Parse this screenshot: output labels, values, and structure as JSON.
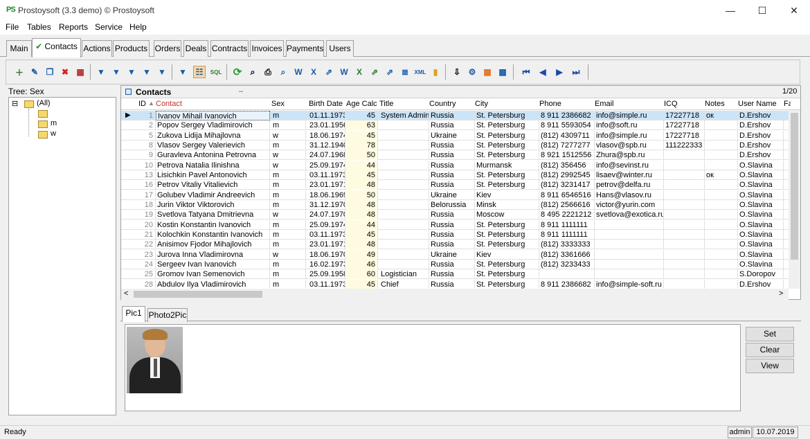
{
  "window": {
    "title": "Prostoysoft (3.3 demo) © Prostoysoft",
    "app_icon_text": "PS",
    "minimize": "—",
    "maximize": "☐",
    "close": "✕"
  },
  "menu": [
    "File",
    "Tables",
    "Reports",
    "Service",
    "Help"
  ],
  "tabs": [
    "Main",
    "Contacts",
    "Actions",
    "Products",
    "Orders",
    "Deals",
    "Contracts",
    "Invoices",
    "Payments",
    "Users"
  ],
  "active_tab_check": "✔",
  "tree": {
    "label": "Tree: Sex",
    "root": "(All)",
    "children": [
      "",
      "m",
      "w"
    ],
    "expander": "⊟"
  },
  "grid": {
    "title": "Contacts",
    "title_mark": "–",
    "pager": "1/20",
    "columns": [
      "ID",
      "Contact",
      "Sex",
      "Birth Date",
      "Age Calc",
      "Title",
      "Country",
      "City",
      "Phone",
      "Email",
      "ICQ",
      "Notes",
      "User Name",
      "Fa"
    ],
    "sort_marker": "▲",
    "row_pointer": "▶",
    "rows": [
      [
        "1",
        "Ivanov Mihail Ivanovich",
        "m",
        "01.11.1973",
        "45",
        "System Adminis",
        "Russia",
        "St. Petersburg",
        "8 911 2386682",
        "info@simple.ru",
        "17227718",
        "ок",
        "D.Ershov"
      ],
      [
        "2",
        "Popov Sergey Vladimirovich",
        "m",
        "23.01.1956",
        "63",
        "",
        "Russia",
        "St. Petersburg",
        "8 911 5593054",
        "info@soft.ru",
        "17227718",
        "",
        "D.Ershov"
      ],
      [
        "5",
        "Zukova Lidija Mihajlovna",
        "w",
        "18.06.1974",
        "45",
        "",
        "Ukraine",
        "St. Petersburg",
        "(812) 4309711",
        "info@simple.ru",
        "17227718",
        "",
        "D.Ershov"
      ],
      [
        "8",
        "Vlasov Sergey Valerievich",
        "m",
        "31.12.1940",
        "78",
        "",
        "Russia",
        "St. Petersburg",
        "(812) 7277277",
        "vlasov@spb.ru",
        "111222333",
        "",
        "D.Ershov"
      ],
      [
        "9",
        "Guravleva Antonina Petrovna",
        "w",
        "24.07.1968",
        "50",
        "",
        "Russia",
        "St. Petersburg",
        "8 921 1512556",
        "Zhura@spb.ru",
        "",
        "",
        "D.Ershov"
      ],
      [
        "10",
        "Petrova Natalia Ilinishna",
        "w",
        "25.09.1974",
        "44",
        "",
        "Russia",
        "Murmansk",
        "(812) 356456",
        "info@sevinst.ru",
        "",
        "",
        "O.Slavina"
      ],
      [
        "13",
        "Lisichkin Pavel Antonovich",
        "m",
        "03.11.1973",
        "45",
        "",
        "Russia",
        "St. Petersburg",
        "(812) 2992545",
        "lisaev@winter.ru",
        "",
        "ок",
        "O.Slavina"
      ],
      [
        "16",
        "Petrov Vitaliy Vitalievich",
        "m",
        "23.01.1971",
        "48",
        "",
        "Russia",
        "St. Petersburg",
        "(812) 3231417",
        "petrov@delfa.ru",
        "",
        "",
        "O.Slavina"
      ],
      [
        "17",
        "Golubev Vladimir Andreevich",
        "m",
        "18.06.1969",
        "50",
        "",
        "Ukraine",
        "Kiev",
        "8 911 6546516",
        "Hans@vlasov.ru",
        "",
        "",
        "O.Slavina"
      ],
      [
        "18",
        "Jurin Viktor Viktorovich",
        "m",
        "31.12.1970",
        "48",
        "",
        "Belorussia",
        "Minsk",
        "(812) 2566616",
        "victor@yurin.com",
        "",
        "",
        "O.Slavina"
      ],
      [
        "19",
        "Svetlova Tatyana Dmitrievna",
        "w",
        "24.07.1970",
        "48",
        "",
        "Russia",
        "Moscow",
        "8 495 2221212",
        "svetlova@exotica.ru",
        "",
        "",
        "O.Slavina"
      ],
      [
        "20",
        "Kostin Konstantin Ivanovich",
        "m",
        "25.09.1974",
        "44",
        "",
        "Russia",
        "St. Petersburg",
        "8 911 1111111",
        "",
        "",
        "",
        "O.Slavina"
      ],
      [
        "21",
        "Kolochkin Konstantin Ivanovich",
        "m",
        "03.11.1973",
        "45",
        "",
        "Russia",
        "St. Petersburg",
        "8 911 1111111",
        "",
        "",
        "",
        "O.Slavina"
      ],
      [
        "22",
        "Anisimov Fjodor Mihajlovich",
        "m",
        "23.01.1971",
        "48",
        "",
        "Russia",
        "St. Petersburg",
        "(812) 3333333",
        "",
        "",
        "",
        "O.Slavina"
      ],
      [
        "23",
        "Jurova Inna Vladimirovna",
        "w",
        "18.06.1970",
        "49",
        "",
        "Ukraine",
        "Kiev",
        "(812) 3361666",
        "",
        "",
        "",
        "O.Slavina"
      ],
      [
        "24",
        "Sergeev Ivan Ivanovich",
        "m",
        "16.02.1973",
        "46",
        "",
        "Russia",
        "St. Petersburg",
        "(812) 3233433",
        "",
        "",
        "",
        "O.Slavina"
      ],
      [
        "25",
        "Gromov Ivan Semenovich",
        "m",
        "25.09.1958",
        "60",
        "Logistician",
        "Russia",
        "St. Petersburg",
        "",
        "",
        "",
        "",
        "S.Doropov"
      ],
      [
        "28",
        "Abdulov Ilya Vladimirovich",
        "m",
        "03.11.1973",
        "45",
        "Chief",
        "Russia",
        "St. Petersburg",
        "8 911 2386682",
        "info@simple-soft.ru",
        "",
        "",
        "D.Ershov"
      ]
    ]
  },
  "pic_tabs": [
    "Pic1",
    "Photo2Pic"
  ],
  "pic_buttons": {
    "set": "Set",
    "clear": "Clear",
    "view": "View"
  },
  "status": {
    "text": "Ready",
    "user": "admin",
    "date": "10.07.2019"
  },
  "scroll": {
    "left": "<",
    "right": ">"
  }
}
